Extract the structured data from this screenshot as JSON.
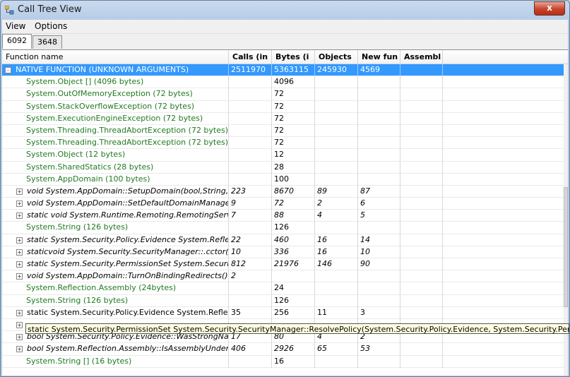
{
  "window": {
    "title": "Call Tree View",
    "close_glyph": "x"
  },
  "menu": [
    "View",
    "Options"
  ],
  "tabs": [
    {
      "label": "6092",
      "active": true
    },
    {
      "label": "3648",
      "active": false
    }
  ],
  "columns": [
    "Function name",
    "Calls (in",
    "Bytes (i",
    "Objects",
    "New fun",
    "Assembl"
  ],
  "rows": [
    {
      "name": "NATIVE FUNCTION (UNKNOWN ARGUMENTS)",
      "calls": "2511970",
      "bytes": "5363115",
      "objects": "245930",
      "newfun": "4569",
      "assembly": "",
      "style": "selected",
      "expander": "-"
    },
    {
      "name": "System.Object [] (4096 bytes)",
      "calls": "",
      "bytes": "4096",
      "objects": "",
      "newfun": "",
      "assembly": "",
      "style": "green",
      "expander": ""
    },
    {
      "name": "System.OutOfMemoryException (72 bytes)",
      "calls": "",
      "bytes": "72",
      "objects": "",
      "newfun": "",
      "assembly": "",
      "style": "green",
      "expander": ""
    },
    {
      "name": "System.StackOverflowException (72 bytes)",
      "calls": "",
      "bytes": "72",
      "objects": "",
      "newfun": "",
      "assembly": "",
      "style": "green",
      "expander": ""
    },
    {
      "name": "System.ExecutionEngineException (72 bytes)",
      "calls": "",
      "bytes": "72",
      "objects": "",
      "newfun": "",
      "assembly": "",
      "style": "green",
      "expander": ""
    },
    {
      "name": "System.Threading.ThreadAbortException (72 bytes)",
      "calls": "",
      "bytes": "72",
      "objects": "",
      "newfun": "",
      "assembly": "",
      "style": "green",
      "expander": ""
    },
    {
      "name": "System.Threading.ThreadAbortException (72 bytes)",
      "calls": "",
      "bytes": "72",
      "objects": "",
      "newfun": "",
      "assembly": "",
      "style": "green",
      "expander": ""
    },
    {
      "name": "System.Object (12 bytes)",
      "calls": "",
      "bytes": "12",
      "objects": "",
      "newfun": "",
      "assembly": "",
      "style": "green",
      "expander": ""
    },
    {
      "name": "System.SharedStatics (28 bytes)",
      "calls": "",
      "bytes": "28",
      "objects": "",
      "newfun": "",
      "assembly": "",
      "style": "green",
      "expander": ""
    },
    {
      "name": "System.AppDomain (100 bytes)",
      "calls": "",
      "bytes": "100",
      "objects": "",
      "newfun": "",
      "assembly": "",
      "style": "green",
      "expander": ""
    },
    {
      "name": "void System.AppDomain::SetupDomain(bool,String,...",
      "calls": "223",
      "bytes": "8670",
      "objects": "89",
      "newfun": "87",
      "assembly": "",
      "style": "italic",
      "expander": "+"
    },
    {
      "name": "void System.AppDomain::SetDefaultDomainManager(...",
      "calls": "9",
      "bytes": "72",
      "objects": "2",
      "newfun": "6",
      "assembly": "",
      "style": "italic",
      "expander": "+"
    },
    {
      "name": "static void System.Runtime.Remoting.RemotingServic...",
      "calls": "7",
      "bytes": "88",
      "objects": "4",
      "newfun": "5",
      "assembly": "",
      "style": "italic",
      "expander": "+"
    },
    {
      "name": "System.String (126 bytes)",
      "calls": "",
      "bytes": "126",
      "objects": "",
      "newfun": "",
      "assembly": "",
      "style": "green",
      "expander": ""
    },
    {
      "name": "static System.Security.Policy.Evidence System.Reflecti...",
      "calls": "22",
      "bytes": "460",
      "objects": "16",
      "newfun": "14",
      "assembly": "",
      "style": "italic",
      "expander": "+"
    },
    {
      "name": "staticvoid System.Security.SecurityManager::.cctor()",
      "calls": "10",
      "bytes": "336",
      "objects": "16",
      "newfun": "10",
      "assembly": "",
      "style": "italic",
      "expander": "+"
    },
    {
      "name": "static System.Security.PermissionSet System.Security....",
      "calls": "812",
      "bytes": "21976",
      "objects": "146",
      "newfun": "90",
      "assembly": "",
      "style": "italic",
      "expander": "+"
    },
    {
      "name": "void System.AppDomain::TurnOnBindingRedirects()",
      "calls": "2",
      "bytes": "",
      "objects": "",
      "newfun": "",
      "assembly": "",
      "style": "italic",
      "expander": "+"
    },
    {
      "name": "System.Reflection.Assembly (24bytes)",
      "calls": "",
      "bytes": "24",
      "objects": "",
      "newfun": "",
      "assembly": "",
      "style": "green",
      "expander": ""
    },
    {
      "name": "System.String (126 bytes)",
      "calls": "",
      "bytes": "126",
      "objects": "",
      "newfun": "",
      "assembly": "",
      "style": "green",
      "expander": ""
    },
    {
      "name": "static System.Security.Policy.Evidence System.Reflecti...",
      "calls": "35",
      "bytes": "256",
      "objects": "11",
      "newfun": "3",
      "assembly": "",
      "style": "normal",
      "expander": "+"
    },
    {
      "name": "",
      "calls": "",
      "bytes": "",
      "objects": "",
      "newfun": "",
      "assembly": "",
      "style": "normal",
      "expander": "+"
    },
    {
      "name": "bool System.Security.Policy.Evidence::WasStrongNam...",
      "calls": "17",
      "bytes": "80",
      "objects": "4",
      "newfun": "2",
      "assembly": "",
      "style": "italic",
      "expander": "+"
    },
    {
      "name": "bool System.Reflection.Assembly::IsAssemblyUnderAp...",
      "calls": "406",
      "bytes": "2926",
      "objects": "65",
      "newfun": "53",
      "assembly": "",
      "style": "italic",
      "expander": "+"
    },
    {
      "name": "System.String [] (16 bytes)",
      "calls": "",
      "bytes": "16",
      "objects": "",
      "newfun": "",
      "assembly": "",
      "style": "green",
      "expander": ""
    }
  ],
  "tooltip": "static System.Security.PermissionSet System.Security.SecurityManager::ResolvePolicy(System.Security.Policy.Evidence, System.Security.PermissionSet"
}
